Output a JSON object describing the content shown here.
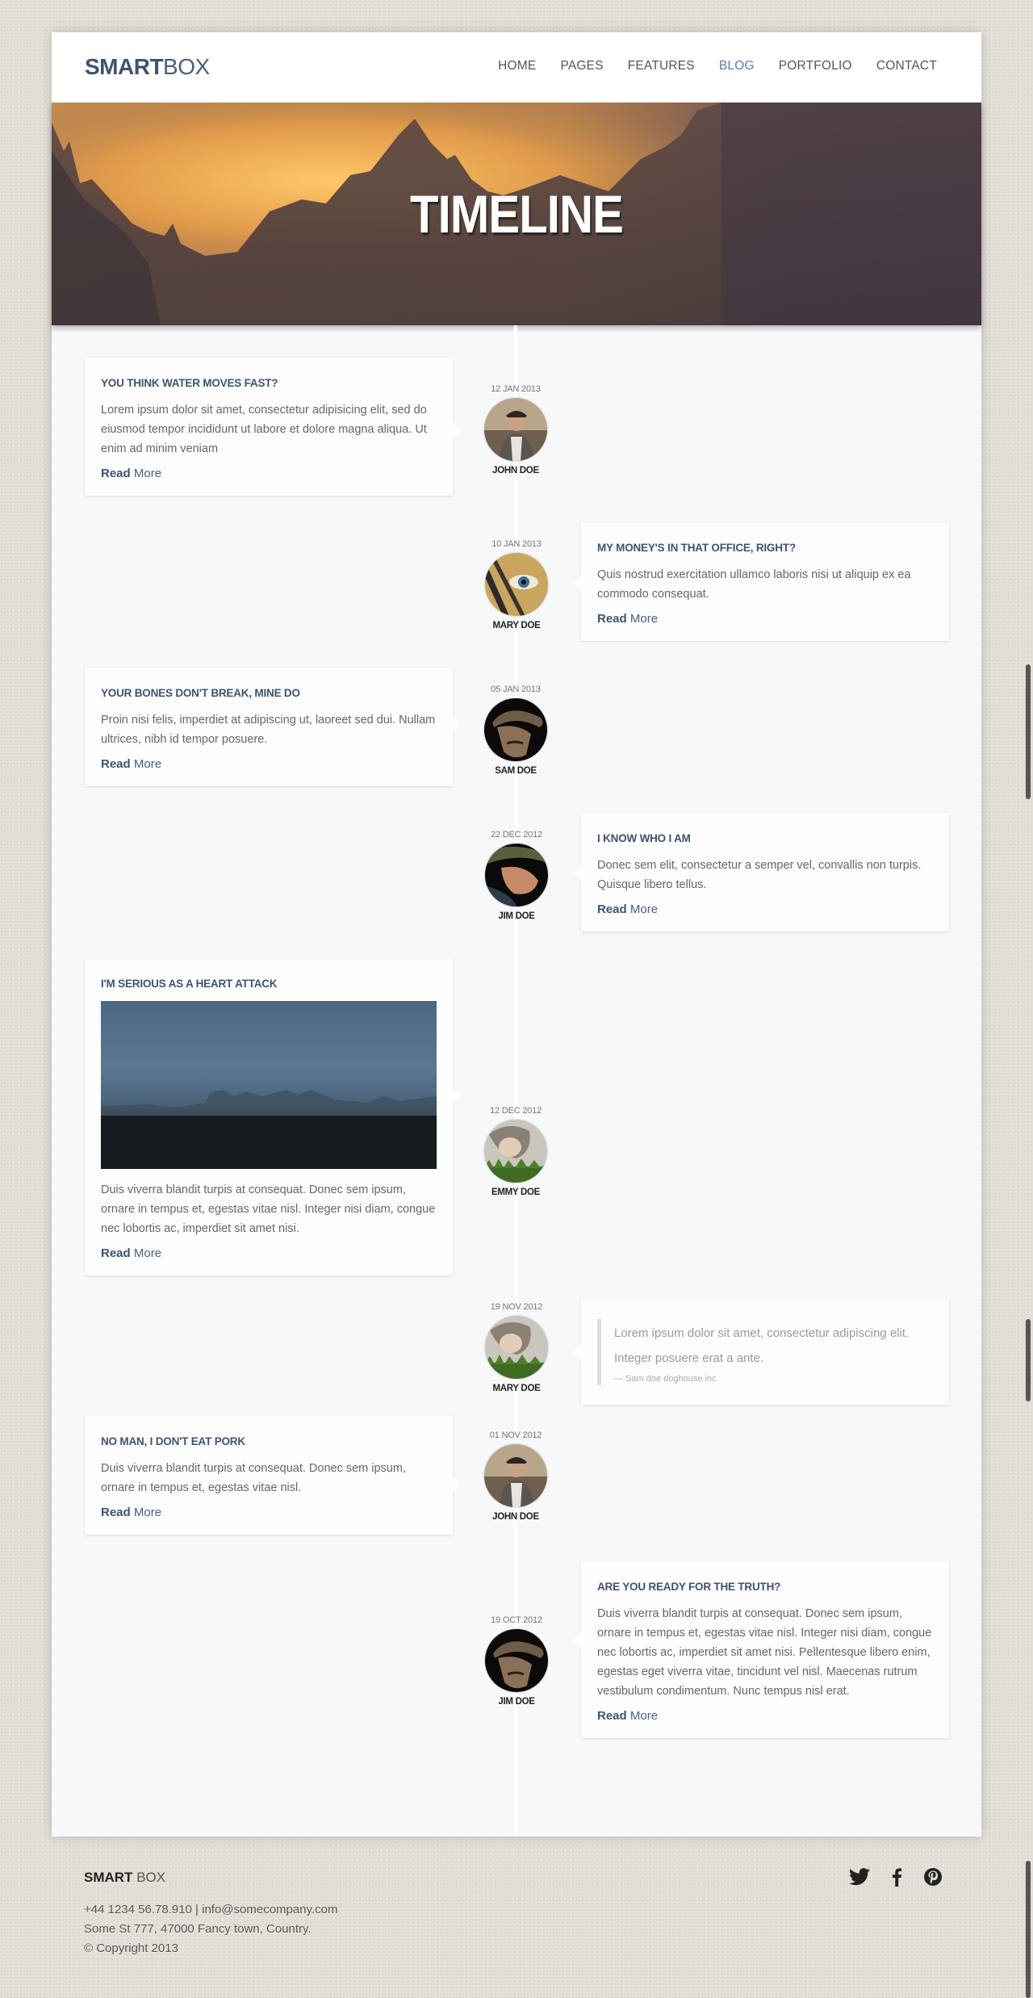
{
  "header": {
    "logo_bold": "SMART",
    "logo_light": "BOX",
    "nav": [
      {
        "label": "HOME",
        "active": false
      },
      {
        "label": "PAGES",
        "active": false
      },
      {
        "label": "FEATURES",
        "active": false
      },
      {
        "label": "BLOG",
        "active": true
      },
      {
        "label": "PORTFOLIO",
        "active": false
      },
      {
        "label": "CONTACT",
        "active": false
      }
    ]
  },
  "hero": {
    "title": "TIMELINE"
  },
  "colors": {
    "accent": "#5a80a6",
    "heading": "#3e5470",
    "background": "#e3dfd8"
  },
  "timeline": [
    {
      "side": "left",
      "date": "12 JAN 2013",
      "author": "JOHN DOE",
      "avatar": "man-in-cap",
      "title": "YOU THINK WATER MOVES FAST?",
      "body": "Lorem ipsum dolor sit amet, consectetur adipisicing elit, sed do eiusmod tempor incididunt ut labore et dolore magna aliqua. Ut enim ad minim veniam",
      "read_bold": "Read",
      "read_more": "More"
    },
    {
      "side": "right",
      "date": "10 JAN 2013",
      "author": "MARY DOE",
      "avatar": "eye-closeup",
      "title": "MY MONEY'S IN THAT OFFICE, RIGHT?",
      "body": "Quis nostrud exercitation ullamco laboris nisi ut aliquip ex ea commodo consequat.",
      "read_bold": "Read",
      "read_more": "More"
    },
    {
      "side": "left",
      "date": "05 JAN 2013",
      "author": "SAM DOE",
      "avatar": "man-in-hat",
      "title": "YOUR BONES DON'T BREAK, MINE DO",
      "body": "Proin nisi felis, imperdiet at adipiscing ut, laoreet sed dui. Nullam ultrices, nibh id tempor posuere.",
      "read_bold": "Read",
      "read_more": "More"
    },
    {
      "side": "right",
      "date": "22 DEC 2012",
      "author": "JIM DOE",
      "avatar": "man-closeup",
      "title": "I KNOW WHO I AM",
      "body": "Donec sem elit, consectetur a semper vel, convallis non turpis. Quisque libero tellus.",
      "read_bold": "Read",
      "read_more": "More"
    },
    {
      "side": "left",
      "date": "12 DEC 2012",
      "author": "EMMY DOE",
      "avatar": "girl-on-grass",
      "title": "I'M SERIOUS AS A HEART ATTACK",
      "image": "foggy-field-photo",
      "body": "Duis viverra blandit turpis at consequat. Donec sem ipsum, ornare in tempus et, egestas vitae nisl. Integer nisi diam, congue nec lobortis ac, imperdiet sit amet nisi.",
      "read_bold": "Read",
      "read_more": "More"
    },
    {
      "side": "right",
      "date": "19 NOV 2012",
      "author": "MARY DOE",
      "avatar": "girl-on-grass",
      "quote_lines": [
        "Lorem ipsum dolor sit amet, consectetur adipiscing elit.",
        "Integer posuere erat a ante."
      ],
      "quote_cite": "— Sam doe doghouse inc"
    },
    {
      "side": "left",
      "date": "01 NOV 2012",
      "author": "JOHN DOE",
      "avatar": "man-in-cap",
      "title": "NO MAN, I DON'T EAT PORK",
      "body": "Duis viverra blandit turpis at consequat. Donec sem ipsum, ornare in tempus et, egestas vitae nisl.",
      "read_bold": "Read",
      "read_more": "More"
    },
    {
      "side": "right",
      "date": "19 OCT 2012",
      "author": "JIM DOE",
      "avatar": "man-in-hat",
      "title": "ARE YOU READY FOR THE TRUTH?",
      "body": "Duis viverra blandit turpis at consequat. Donec sem ipsum, ornare in tempus et, egestas vitae nisl. Integer nisi diam, congue nec lobortis ac, imperdiet sit amet nisi. Pellentesque libero enim, egestas eget viverra vitae, tincidunt vel nisl. Maecenas rutrum vestibulum condimentum. Nunc tempus nisl erat.",
      "read_bold": "Read",
      "read_more": "More"
    }
  ],
  "footer": {
    "logo_bold": "SMART",
    "logo_light": "BOX",
    "contact": "+44 1234 56.78.910 | info@somecompany.com",
    "address": "Some St 777, 47000 Fancy town, Country.",
    "copyright": "© Copyright 2013",
    "social": [
      {
        "icon": "twitter-icon"
      },
      {
        "icon": "facebook-icon"
      },
      {
        "icon": "pinterest-icon"
      }
    ]
  }
}
